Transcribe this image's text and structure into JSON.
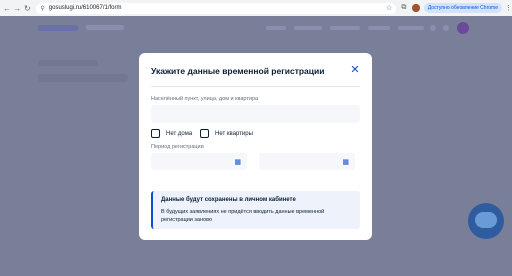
{
  "browser": {
    "url": "gosuslugi.ru/610067/1/form",
    "update_button": "Доступно обновление Chrome",
    "nav_back_icon": "back-arrow",
    "nav_forward_icon": "forward-arrow",
    "reload_icon": "reload"
  },
  "modal": {
    "title": "Укажите данные временной регистрации",
    "address_label": "Населённый пункт, улица, дом и квартира",
    "address_value": "",
    "checkbox_no_house": "Нет дома",
    "checkbox_no_apartment": "Нет квартиры",
    "period_label": "Период регистрации",
    "date_from": "",
    "date_to": "",
    "info_title": "Данные будут сохранены в личном кабинете",
    "info_text": "В будущих заявлениях не придётся вводить данные временной регистрации заново"
  },
  "colors": {
    "accent": "#0d4cd3",
    "overlay": "#7a7f99",
    "info_bg": "#eef2fb"
  }
}
